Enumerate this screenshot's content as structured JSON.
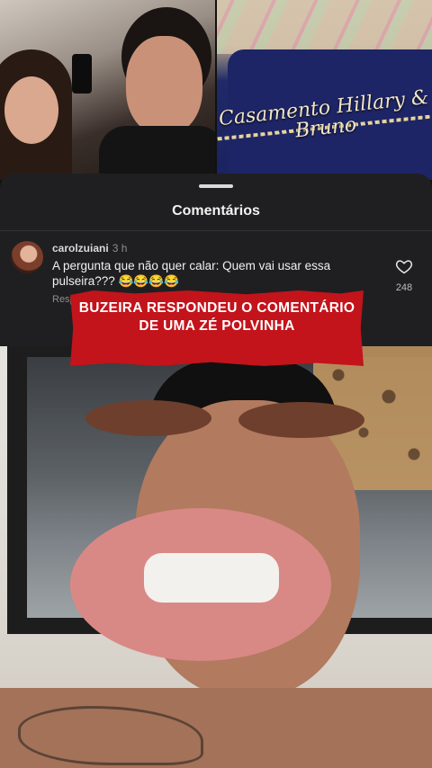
{
  "top_images": {
    "right_bracelet_text": "Casamento Hillary & Bruno"
  },
  "comments_sheet": {
    "title": "Comentários",
    "comment": {
      "username": "carolzuiani",
      "time": "3 h",
      "text": "A pergunta que não quer calar: Quem vai usar essa pulseira??? 😂😂😂😂",
      "reply_label": "Responder",
      "like_count": "248",
      "icons": [
        "avatar",
        "heart-icon"
      ]
    }
  },
  "banner": {
    "text": "BUZEIRA RESPONDEU O COMENTÁRIO DE UMA ZÉ POLVINHA",
    "color": "#c3131b"
  },
  "colors": {
    "sheet_bg": "#1f1f21",
    "text": "#f0f0f0",
    "muted": "#8e8e8e"
  }
}
